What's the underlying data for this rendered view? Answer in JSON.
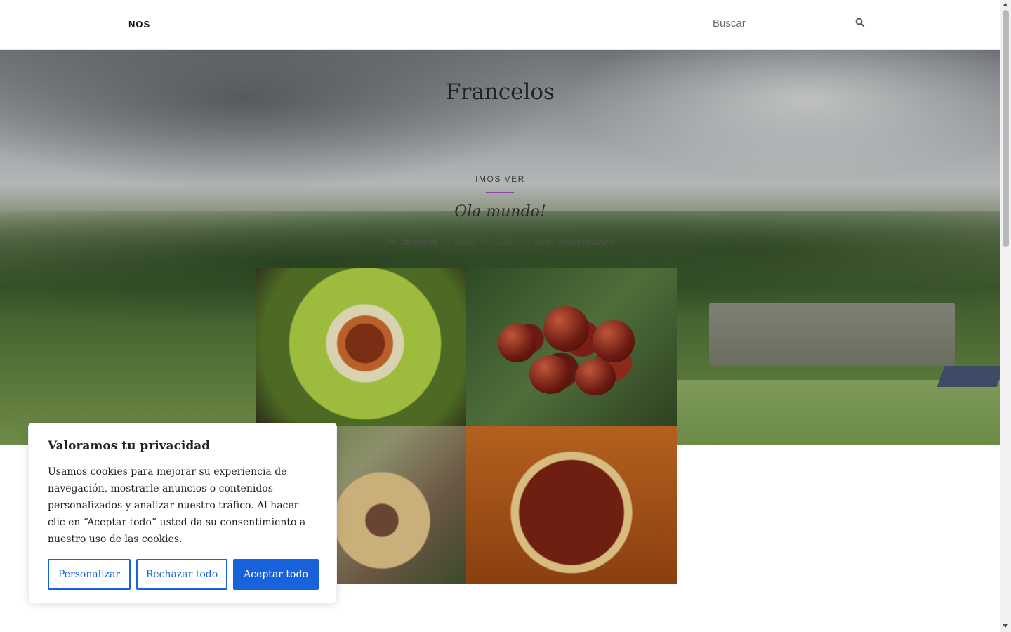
{
  "header": {
    "nav_label": "NOS",
    "search_placeholder": "Buscar",
    "search_icon": "search-icon"
  },
  "hero": {
    "site_title": "Francelos",
    "category": "IMOS VER",
    "post_title": "Ola mundo!",
    "post_meta": "Po Internet ... Maio 10, 2016 ... Sem comentarios",
    "accent_color": "#8e44ad"
  },
  "cookie_banner": {
    "title": "Valoramos tu privacidad",
    "body": "Usamos cookies para mejorar su experiencia de navegación, mostrarle anuncios o contenidos personalizados y analizar nuestro tráfico. Al hacer clic en “Aceptar todo” usted da su consentimiento a nuestro uso de las cookies.",
    "customize_label": "Personalizar",
    "reject_label": "Rechazar todo",
    "accept_label": "Aceptar todo",
    "button_color": "#1863dc"
  }
}
